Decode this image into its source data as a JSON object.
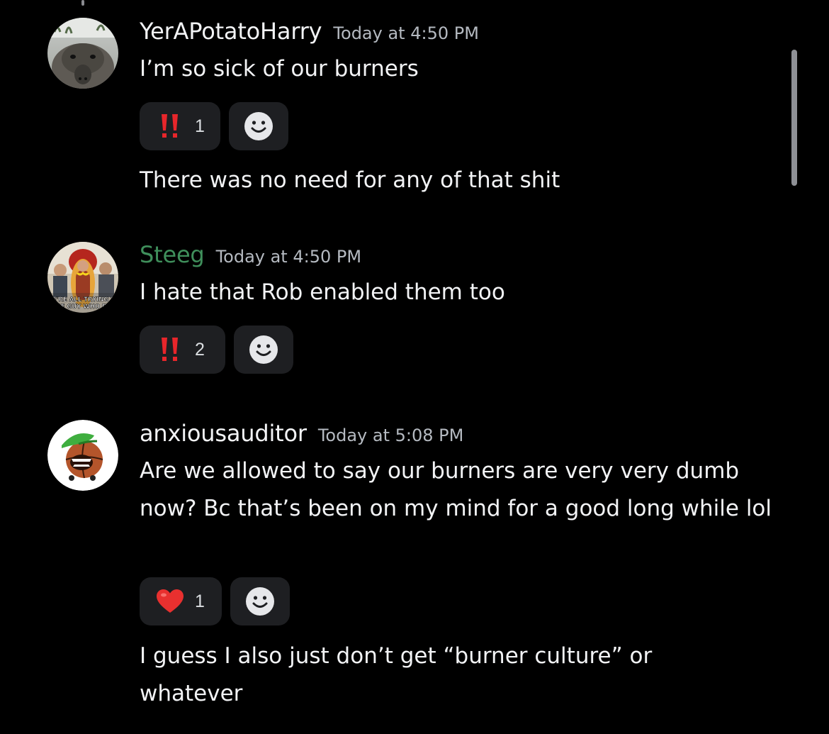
{
  "messages": [
    {
      "username": "YerAPotatoHarry",
      "username_color": "#f2f3f5",
      "timestamp": "Today at 4:50 PM",
      "avatar": "anteater-photo-avatar",
      "lines": [
        {
          "text": "I’m so sick of our burners"
        },
        {
          "text": "There was no need for any of that shit"
        }
      ],
      "reactions": [
        {
          "emoji": "double-exclamation-icon",
          "emoji_char": "‼",
          "count": "1"
        }
      ]
    },
    {
      "username": "Steeg",
      "username_color": "#3f8f5b",
      "timestamp": "Today at 4:50 PM",
      "avatar": "hotdog-costume-meme-avatar",
      "avatar_caption_lines": [
        "WE'RE ALL TRYING TO",
        "THE GUY WHO DID"
      ],
      "lines": [
        {
          "text": "I hate that Rob enabled them too"
        }
      ],
      "reactions": [
        {
          "emoji": "double-exclamation-icon",
          "emoji_char": "‼",
          "count": "2"
        }
      ]
    },
    {
      "username": "anxiousauditor",
      "username_color": "#f2f3f5",
      "timestamp": "Today at 5:08 PM",
      "avatar": "basketball-cartoon-avatar",
      "lines": [
        {
          "text": "Are we allowed to say our burners are very very dumb now? Bc that’s been on my mind for a good long while lol"
        },
        {
          "text": "I guess I also just don’t get “burner culture” or whatever"
        }
      ],
      "reactions": [
        {
          "emoji": "red-heart-icon",
          "emoji_char": "❤",
          "count": "1"
        }
      ]
    }
  ],
  "add_reaction_icon": "smiley-face-icon",
  "colors": {
    "background": "#000000",
    "reaction_bg": "#1e1f22",
    "timestamp": "#b5bac1",
    "exclamation_red": "#e8262b",
    "heart_red": "#e8302f",
    "scrollbar": "#8e9095"
  }
}
